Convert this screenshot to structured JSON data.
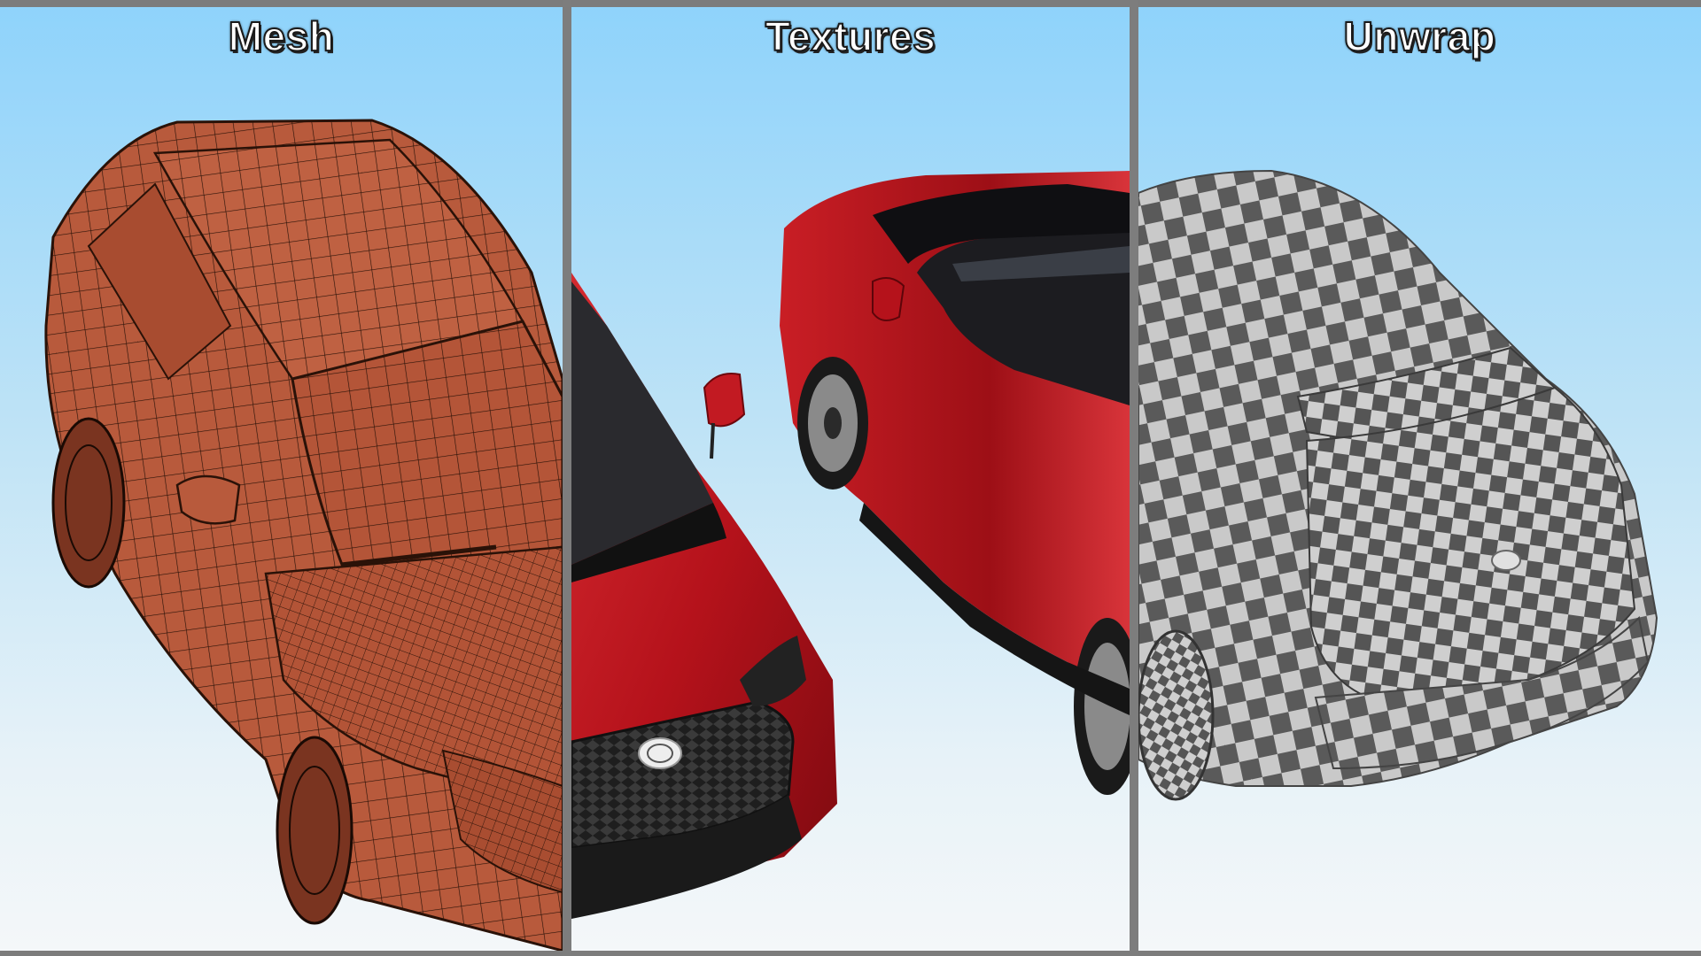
{
  "panels": [
    {
      "id": "mesh",
      "title": "Mesh"
    },
    {
      "id": "textures",
      "title": "Textures"
    },
    {
      "id": "unwrap",
      "title": "Unwrap"
    }
  ],
  "colors": {
    "sky_top": "#8fd3fb",
    "sky_bottom": "#f4f7f9",
    "mesh_fill": "#b85a3c",
    "mesh_wire": "#2a1208",
    "car_red": "#b5121b",
    "checker_dark": "#5a5a5a",
    "checker_light": "#c9c9c9",
    "divider": "#7d7d7d"
  }
}
